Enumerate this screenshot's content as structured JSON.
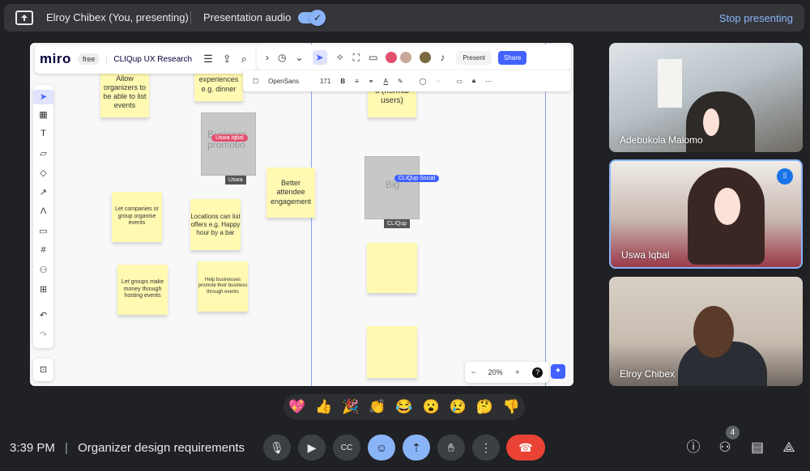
{
  "topbar": {
    "presenter": "Elroy Chibex (You, presenting)",
    "audio_label": "Presentation audio",
    "stop_label": "Stop presenting"
  },
  "miro": {
    "logo": "miro",
    "plan": "free",
    "board_name": "CLIQup UX Research",
    "present_label": "Present",
    "share_label": "Share",
    "font_name": "OpenSans",
    "font_size": "171",
    "zoom": "20%",
    "help": "?",
    "stickies": {
      "s1": "Allow organizers to be able to list events",
      "s2": "list experiences e.g. dinner",
      "s3": "s (normal users)",
      "s4": "Better attendee engagement",
      "s5": "Let companies or group organise events",
      "s6": "Locations can list offers e.g. Happy hour by a bar",
      "s7": "Let groups make money through hosting events",
      "s8": "Help businesses promote their business through events"
    },
    "image1_text": "Business promotio",
    "image2_text": "Big",
    "cursor1": "Uswa Iqbal",
    "cursor2": "CLIQup Social",
    "tag1": "Uswa",
    "tag2": "CLIQup"
  },
  "participants": [
    {
      "name": "Adebukola Malomo"
    },
    {
      "name": "Uswa Iqbal"
    },
    {
      "name": "Elroy Chibex"
    }
  ],
  "reactions": [
    "💖",
    "👍",
    "🎉",
    "👏",
    "😂",
    "😮",
    "😢",
    "🤔",
    "👎"
  ],
  "bottom": {
    "time": "3:39 PM",
    "meeting_title": "Organizer design requirements",
    "people_count": "4"
  },
  "colors": {
    "accent": "#8ab4f8",
    "miro_blue": "#4262ff",
    "sticky": "#fff9b1",
    "end_call": "#ea4335"
  }
}
